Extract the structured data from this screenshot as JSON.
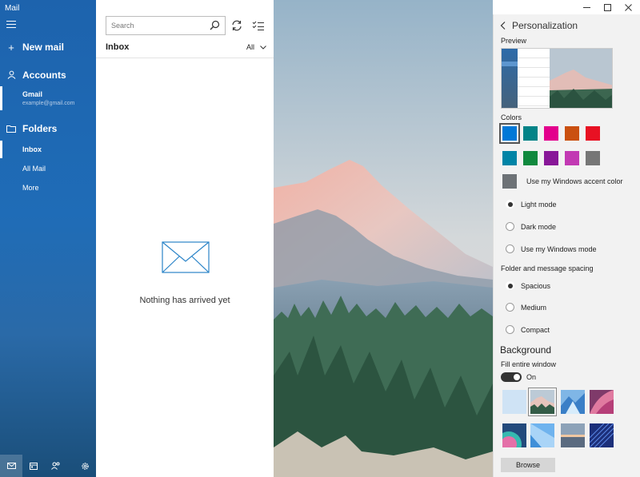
{
  "app": {
    "title": "Mail"
  },
  "nav": {
    "new_mail": "New mail",
    "accounts": "Accounts",
    "account_name": "Gmail",
    "account_email": "example@gmail.com",
    "folders": "Folders",
    "folder_items": [
      "Inbox",
      "All Mail",
      "More"
    ]
  },
  "list": {
    "search_placeholder": "Search",
    "title": "Inbox",
    "filter": "All",
    "empty_message": "Nothing has arrived yet"
  },
  "panel": {
    "title": "Personalization",
    "preview_label": "Preview",
    "colors_label": "Colors",
    "swatches": [
      "#0078d7",
      "#038387",
      "#e3008c",
      "#ca5010",
      "#e81123",
      "#0084a6",
      "#10893e",
      "#881798",
      "#c239b3",
      "#767676"
    ],
    "selected_swatch": 0,
    "accent_label": "Use my Windows accent color",
    "modes": [
      "Light mode",
      "Dark mode",
      "Use my Windows mode"
    ],
    "selected_mode": 0,
    "spacing_label": "Folder and message spacing",
    "spacings": [
      "Spacious",
      "Medium",
      "Compact"
    ],
    "selected_spacing": 0,
    "background_heading": "Background",
    "fill_label": "Fill entire window",
    "fill_state": "On",
    "browse_label": "Browse"
  },
  "colors": {
    "nav_blue": "#1f6cb7",
    "accent": "#0078d7"
  }
}
